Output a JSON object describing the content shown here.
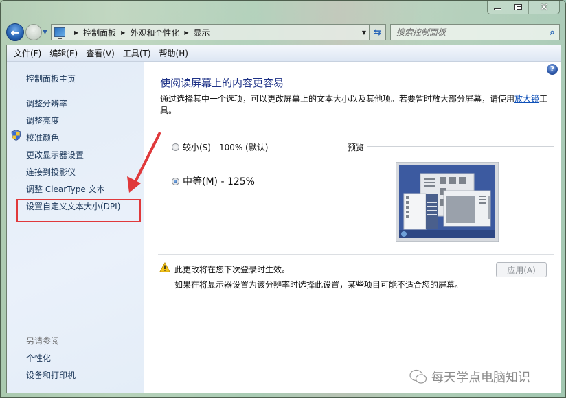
{
  "window": {
    "caption_buttons": [
      "minimize",
      "maximize",
      "close"
    ]
  },
  "nav": {
    "breadcrumb": [
      "控制面板",
      "外观和个性化",
      "显示"
    ],
    "search_placeholder": "搜索控制面板"
  },
  "menubar": {
    "items": [
      "文件(F)",
      "编辑(E)",
      "查看(V)",
      "工具(T)",
      "帮助(H)"
    ]
  },
  "sidebar": {
    "home": "控制面板主页",
    "links": [
      "调整分辨率",
      "调整亮度",
      "校准颜色",
      "更改显示器设置",
      "连接到投影仪",
      "调整 ClearType 文本",
      "设置自定义文本大小(DPI)"
    ],
    "see_also_heading": "另请参阅",
    "see_also": [
      "个性化",
      "设备和打印机"
    ]
  },
  "main": {
    "title": "使阅读屏幕上的内容更容易",
    "description_before_link": "通过选择其中一个选项，可以更改屏幕上的文本大小以及其他项。若要暂时放大部分屏幕，请使用",
    "description_link": "放大镜",
    "description_after_link": "工具。",
    "options": [
      {
        "label": "较小(S) - 100% (默认)",
        "selected": false
      },
      {
        "label": "中等(M) - 125%",
        "selected": true
      }
    ],
    "preview_label": "预览",
    "warning": "此更改将在您下次登录时生效。",
    "warning_sub": "如果在将显示器设置为该分辨率时选择此设置，某些项目可能不适合您的屏幕。",
    "apply_button": "应用(A)"
  },
  "annotation": {
    "highlight_color": "#e0393b"
  },
  "watermark": "每天学点电脑知识"
}
